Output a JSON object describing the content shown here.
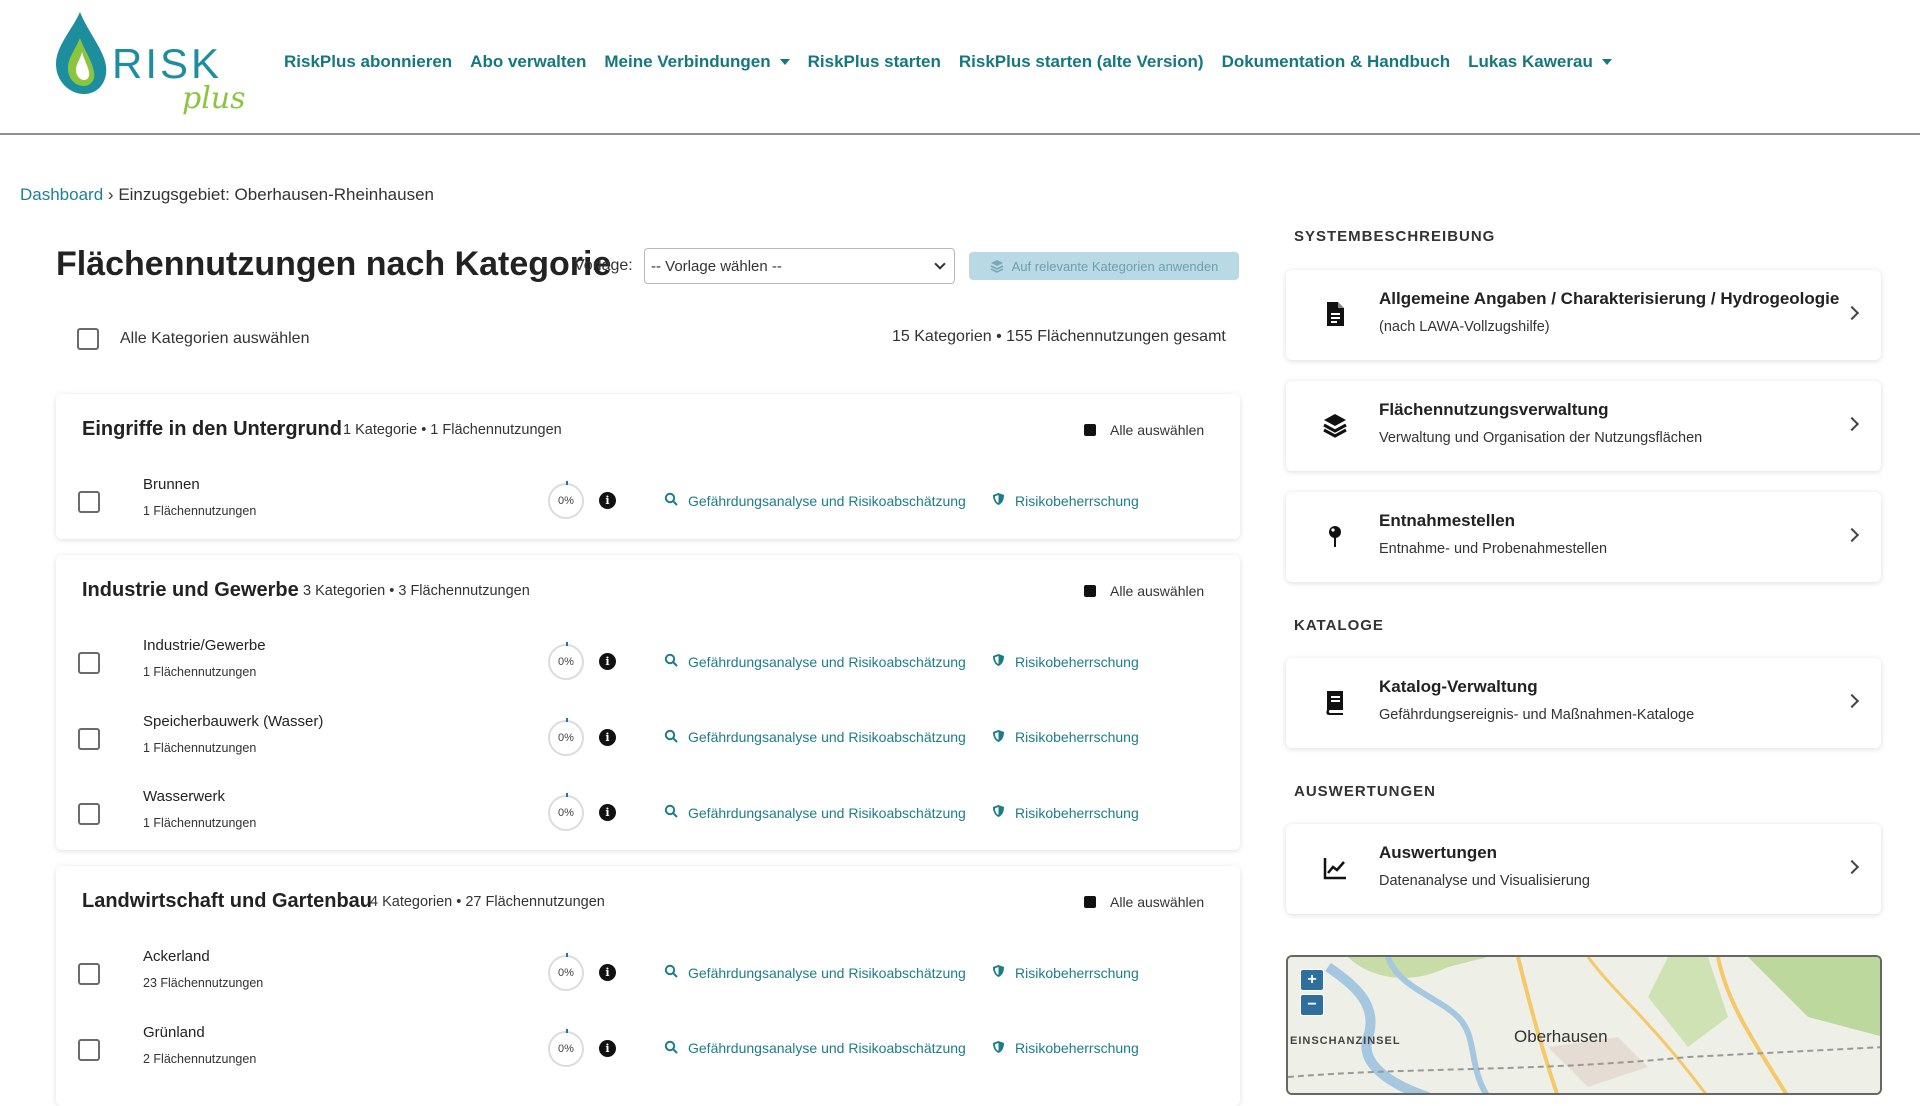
{
  "brand": {
    "logo_text": "RISK",
    "logo_script": "plus"
  },
  "nav": {
    "items": [
      {
        "label": "RiskPlus abonnieren",
        "dropdown": false
      },
      {
        "label": "Abo verwalten",
        "dropdown": false
      },
      {
        "label": "Meine Verbindungen",
        "dropdown": true
      },
      {
        "label": "RiskPlus starten",
        "dropdown": false
      },
      {
        "label": "RiskPlus starten (alte Version)",
        "dropdown": false
      },
      {
        "label": "Dokumentation & Handbuch",
        "dropdown": false
      },
      {
        "label": "Lukas Kawerau",
        "dropdown": true
      }
    ]
  },
  "breadcrumb": {
    "home": "Dashboard",
    "separator": "›",
    "current": "Einzugsgebiet: Oberhausen-Rheinhausen"
  },
  "main": {
    "title": "Flächennutzungen nach Kategorie",
    "vorlage_label": "Vorlage:",
    "vorlage_value": "-- Vorlage wählen --",
    "apply_label": "Auf relevante Kategorien anwenden",
    "select_all_label": "Alle Kategorien auswählen",
    "totals": "15 Kategorien • 155 Flächennutzungen gesamt",
    "card_select_all": "Alle auswählen",
    "link_analysis": "Gefährdungsanalyse und Risikoabschätzung",
    "link_control": "Risikobeherrschung",
    "groups": [
      {
        "title": "Eingriffe in den Untergrund",
        "meta": "1 Kategorie • 1 Flächennutzungen",
        "rows": [
          {
            "name": "Brunnen",
            "count": "1 Flächennutzungen",
            "pct": "0%"
          }
        ]
      },
      {
        "title": "Industrie und Gewerbe",
        "meta": "3 Kategorien • 3 Flächennutzungen",
        "rows": [
          {
            "name": "Industrie/Gewerbe",
            "count": "1 Flächennutzungen",
            "pct": "0%"
          },
          {
            "name": "Speicherbauwerk (Wasser)",
            "count": "1 Flächennutzungen",
            "pct": "0%"
          },
          {
            "name": "Wasserwerk",
            "count": "1 Flächennutzungen",
            "pct": "0%"
          }
        ]
      },
      {
        "title": "Landwirtschaft und Gartenbau",
        "meta": "4 Kategorien • 27 Flächennutzungen",
        "rows": [
          {
            "name": "Ackerland",
            "count": "23 Flächennutzungen",
            "pct": "0%"
          },
          {
            "name": "Grünland",
            "count": "2 Flächennutzungen",
            "pct": "0%"
          }
        ]
      }
    ]
  },
  "sidebar": {
    "sections": {
      "system": "SYSTEMBESCHREIBUNG",
      "kataloge": "KATALOGE",
      "auswertungen": "AUSWERTUNGEN"
    },
    "cards": [
      {
        "title": "Allgemeine Angaben / Charakterisierung / Hydrogeologie",
        "sub": "(nach LAWA-Vollzugshilfe)",
        "icon": "document-icon"
      },
      {
        "title": "Flächennutzungsverwaltung",
        "sub": "Verwaltung und Organisation der Nutzungsflächen",
        "icon": "layers-icon"
      },
      {
        "title": "Entnahmestellen",
        "sub": "Entnahme- und Probenahmestellen",
        "icon": "map-pin-icon"
      },
      {
        "title": "Katalog-Verwaltung",
        "sub": "Gefährdungsereignis- und Maßnahmen-Kataloge",
        "icon": "book-icon"
      },
      {
        "title": "Auswertungen",
        "sub": "Datenanalyse und Visualisierung",
        "icon": "chart-line-icon"
      }
    ]
  },
  "map": {
    "zoom_in": "+",
    "zoom_out": "−",
    "label_island": "EINSCHANZINSEL",
    "label_town": "Oberhausen"
  },
  "colors": {
    "accent": "#16787f",
    "link": "#1c7d8a",
    "breadcrumb_link": "#1f7f9a",
    "apply_bg": "#b9d9e4"
  }
}
